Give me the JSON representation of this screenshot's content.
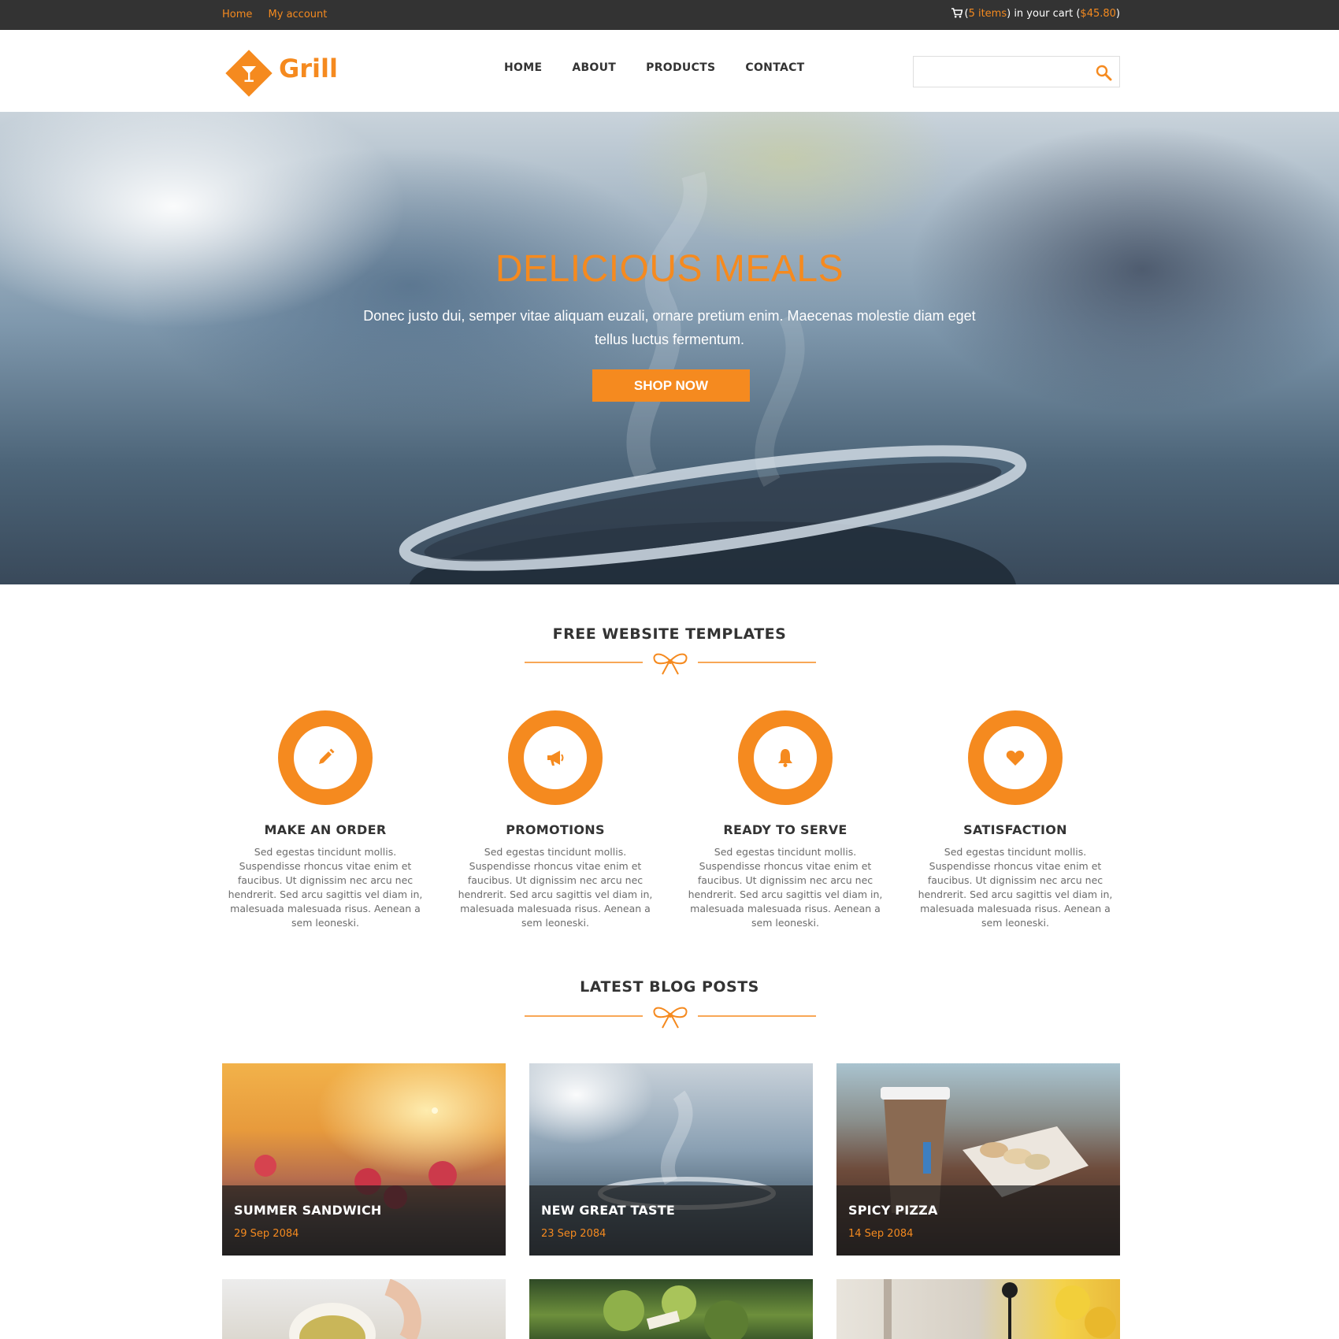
{
  "topbar": {
    "links": [
      "Home",
      "My account"
    ],
    "cart": {
      "open": "(",
      "items": "5 items",
      "middle": ") in your cart (",
      "total": "$45.80",
      "close": ")"
    }
  },
  "header": {
    "logo_text": "Grill",
    "nav": [
      "HOME",
      "ABOUT",
      "PRODUCTS",
      "CONTACT"
    ],
    "search": {
      "placeholder": "",
      "value": ""
    }
  },
  "hero": {
    "title": "DELICIOUS MEALS",
    "text": "Donec justo dui, semper vitae aliquam euzali, ornare pretium enim. Maecenas molestie diam eget tellus luctus fermentum.",
    "button": "SHOP NOW"
  },
  "features_section": {
    "title": "FREE WEBSITE TEMPLATES",
    "items": [
      {
        "icon": "pencil-icon",
        "title": "MAKE AN ORDER",
        "text": "Sed egestas tincidunt mollis. Suspendisse rhoncus vitae enim et faucibus. Ut dignissim nec arcu nec hendrerit. Sed arcu sagittis vel diam in, malesuada malesuada risus. Aenean a sem leoneski."
      },
      {
        "icon": "megaphone-icon",
        "title": "PROMOTIONS",
        "text": "Sed egestas tincidunt mollis. Suspendisse rhoncus vitae enim et faucibus. Ut dignissim nec arcu nec hendrerit. Sed arcu sagittis vel diam in, malesuada malesuada risus. Aenean a sem leoneski."
      },
      {
        "icon": "bell-icon",
        "title": "READY TO SERVE",
        "text": "Sed egestas tincidunt mollis. Suspendisse rhoncus vitae enim et faucibus. Ut dignissim nec arcu nec hendrerit. Sed arcu sagittis vel diam in, malesuada malesuada risus. Aenean a sem leoneski."
      },
      {
        "icon": "heart-icon",
        "title": "SATISFACTION",
        "text": "Sed egestas tincidunt mollis. Suspendisse rhoncus vitae enim et faucibus. Ut dignissim nec arcu nec hendrerit. Sed arcu sagittis vel diam in, malesuada malesuada risus. Aenean a sem leoneski."
      }
    ]
  },
  "blog_section": {
    "title": "LATEST BLOG POSTS",
    "posts": [
      {
        "title": "SUMMER SANDWICH",
        "date": "29 Sep 2084"
      },
      {
        "title": "NEW GREAT TASTE",
        "date": "23 Sep 2084"
      },
      {
        "title": "SPICY PIZZA",
        "date": "14 Sep 2084"
      }
    ]
  },
  "colors": {
    "accent": "#f58a1f",
    "topbar": "#333333",
    "text": "#333333",
    "muted": "#6b6b6b"
  }
}
